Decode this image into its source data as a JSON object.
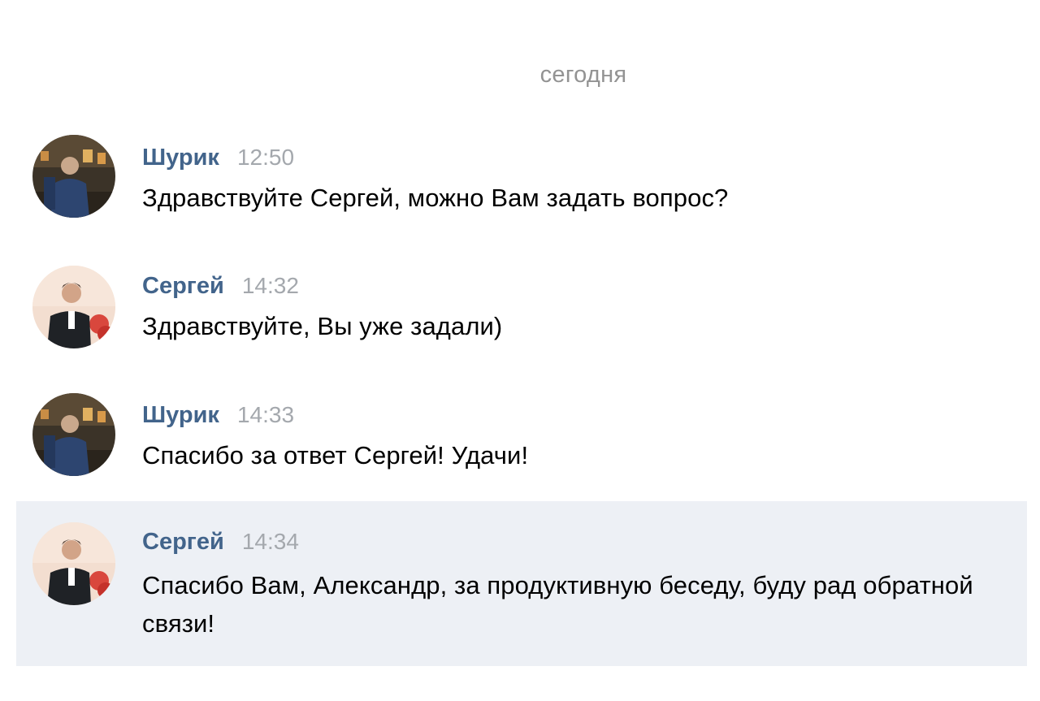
{
  "date_divider": "сегодня",
  "messages": [
    {
      "author": "Шурик",
      "time": "12:50",
      "text": "Здравствуйте Сергей, можно Вам задать вопрос?",
      "avatar": "avatar-shurik"
    },
    {
      "author": "Сергей",
      "time": "14:32",
      "text": "Здравствуйте, Вы уже задали)",
      "avatar": "avatar-sergey"
    },
    {
      "author": "Шурик",
      "time": "14:33",
      "text": "Спасибо за ответ Сергей! Удачи!",
      "avatar": "avatar-shurik"
    },
    {
      "author": "Сергей",
      "time": "14:34",
      "text": "Спасибо Вам, Александр, за продуктивную беседу, буду рад обратной связи!",
      "avatar": "avatar-sergey"
    }
  ],
  "colors": {
    "author": "#42648b",
    "time": "#a4a8ad",
    "date": "#939393",
    "highlight_bg": "#edf0f5"
  }
}
